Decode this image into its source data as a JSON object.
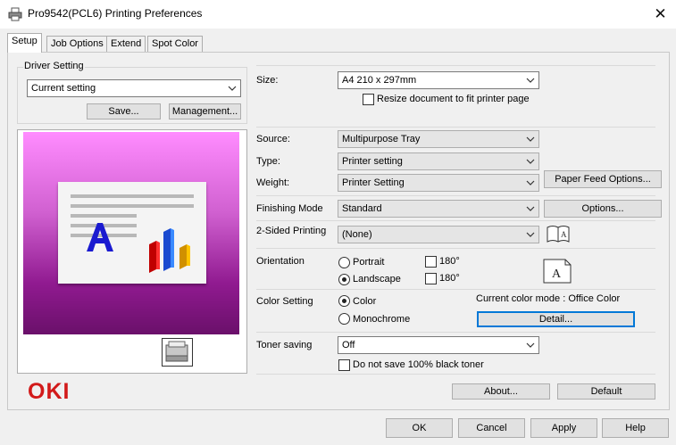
{
  "window": {
    "title": "Pro9542(PCL6) Printing Preferences"
  },
  "tabs": [
    {
      "label": "Setup",
      "active": true
    },
    {
      "label": "Job Options",
      "active": false
    },
    {
      "label": "Extend",
      "active": false
    },
    {
      "label": "Spot Color",
      "active": false
    }
  ],
  "driver_setting": {
    "group_label": "Driver Setting",
    "selected": "Current setting",
    "save_label": "Save...",
    "management_label": "Management..."
  },
  "brand": {
    "logo_text": "OKI",
    "logo_color": "#d21a1a"
  },
  "size": {
    "label": "Size:",
    "selected": "A4 210 x 297mm",
    "resize_label": "Resize document to fit printer page",
    "resize_checked": false
  },
  "source": {
    "label": "Source:",
    "selected": "Multipurpose Tray"
  },
  "type": {
    "label": "Type:",
    "selected": "Printer setting"
  },
  "weight": {
    "label": "Weight:",
    "selected": "Printer Setting"
  },
  "paper_feed_label": "Paper Feed Options...",
  "finishing": {
    "label": "Finishing Mode",
    "selected": "Standard",
    "options_label": "Options..."
  },
  "two_sided": {
    "label": "2-Sided Printing",
    "selected": "(None)"
  },
  "orientation": {
    "label": "Orientation",
    "portrait_label": "Portrait",
    "landscape_label": "Landscape",
    "selected": "Landscape",
    "rotate_label": "180°",
    "rotate_portrait_checked": false,
    "rotate_landscape_checked": false
  },
  "color": {
    "label": "Color Setting",
    "color_label": "Color",
    "mono_label": "Monochrome",
    "selected": "Color",
    "mode_text": "Current color mode : Office Color",
    "detail_label": "Detail..."
  },
  "toner": {
    "label": "Toner saving",
    "selected": "Off",
    "no_black_label": "Do not save 100% black toner",
    "no_black_checked": false
  },
  "about_label": "About...",
  "default_label": "Default",
  "footer": {
    "ok_label": "OK",
    "cancel_label": "Cancel",
    "apply_label": "Apply",
    "help_label": "Help"
  }
}
